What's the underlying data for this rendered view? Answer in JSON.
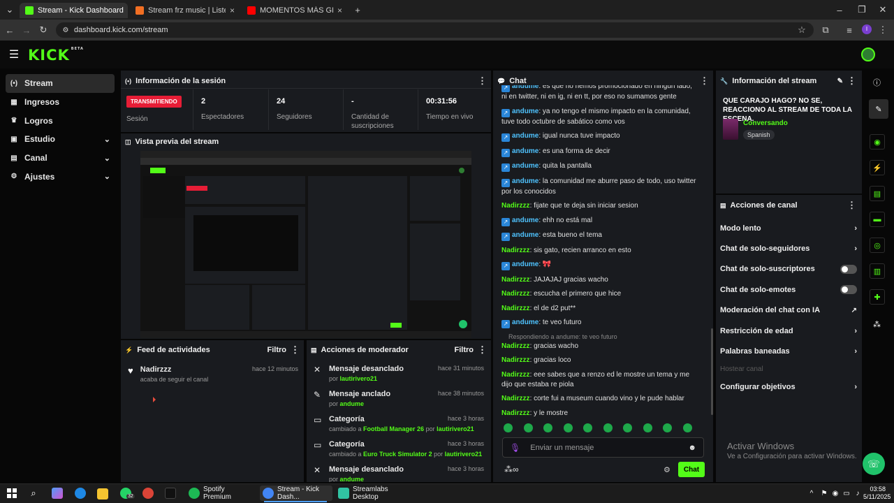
{
  "browser": {
    "tabs": [
      {
        "title": "Stream - Kick Dashboard",
        "color": "#53fc18"
      },
      {
        "title": "Stream frz music | Listen to son",
        "color": "#f26f23"
      },
      {
        "title": "MOMENTOS MÁS GRACIOSOS",
        "color": "#ff0000"
      }
    ],
    "url": "dashboard.kick.com/stream"
  },
  "app": {
    "logo": "KICK",
    "beta": "BETA"
  },
  "nav": [
    {
      "label": "Stream",
      "icon": "broadcast-icon"
    },
    {
      "label": "Ingresos",
      "icon": "money-icon"
    },
    {
      "label": "Logros",
      "icon": "trophy-icon"
    },
    {
      "label": "Estudio",
      "icon": "grid-icon"
    },
    {
      "label": "Canal",
      "icon": "channel-icon"
    },
    {
      "label": "Ajustes",
      "icon": "gear-icon"
    }
  ],
  "session": {
    "title": "Información de la sesión",
    "live_label": "TRANSMITIENDO",
    "session_label": "Sesión",
    "stats": [
      {
        "value": "2",
        "label": "Espectadores"
      },
      {
        "value": "24",
        "label": "Seguidores"
      },
      {
        "value": "-",
        "label": "Cantidad de suscripciones"
      },
      {
        "value": "00:31:56",
        "label": "Tiempo en vivo"
      }
    ]
  },
  "preview": {
    "title": "Vista previa del stream"
  },
  "feed": {
    "title": "Feed de actividades",
    "filter": "Filtro",
    "items": [
      {
        "user": "Nadirzzz",
        "text": "acaba de seguir el canal",
        "time": "hace 12 minutos"
      }
    ]
  },
  "mod": {
    "title": "Acciones de moderador",
    "filter": "Filtro",
    "items": [
      {
        "title": "Mensaje desanclado",
        "pre": "por",
        "a": "lautirivero21",
        "mid": "",
        "b": "",
        "time": "hace 31 minutos"
      },
      {
        "title": "Mensaje anclado",
        "pre": "por",
        "a": "andume",
        "mid": "",
        "b": "",
        "time": "hace 38 minutos"
      },
      {
        "title": "Categoría",
        "pre": "cambiado a",
        "a": "Football Manager 26",
        "mid": "por",
        "b": "lautirivero21",
        "time": "hace 3 horas"
      },
      {
        "title": "Categoría",
        "pre": "cambiado a",
        "a": "Euro Truck Simulator 2",
        "mid": "por",
        "b": "lautirivero21",
        "time": "hace 3 horas"
      },
      {
        "title": "Mensaje desanclado",
        "pre": "por",
        "a": "andume",
        "mid": "",
        "b": "",
        "time": "hace 3 horas"
      }
    ]
  },
  "chat": {
    "title": "Chat",
    "messages": [
      {
        "user": "andume",
        "type": "mod",
        "text": "es que no hemos promocionado en ningun lado, ni en twitter, ni en ig, ni en tt, por eso no sumamos gente"
      },
      {
        "user": "andume",
        "type": "mod",
        "text": "ya no tengo el mismo impacto en la comunidad, tuve todo octubre de sabático como vos"
      },
      {
        "user": "andume",
        "type": "mod",
        "text": "igual nunca tuve impacto"
      },
      {
        "user": "andume",
        "type": "mod",
        "text": "es una forma de decir"
      },
      {
        "user": "andume",
        "type": "mod",
        "text": "quita la pantalla"
      },
      {
        "user": "andume",
        "type": "mod",
        "text": "la comunidad me aburre paso de todo, uso twitter por los conocidos"
      },
      {
        "user": "Nadirzzz",
        "type": "user",
        "text": "fijate que te deja sin iniciar sesion"
      },
      {
        "user": "andume",
        "type": "mod",
        "text": "ehh no está mal"
      },
      {
        "user": "andume",
        "type": "mod",
        "text": "esta bueno el tema"
      },
      {
        "user": "Nadirzzz",
        "type": "user",
        "text": "sis gato, recien arranco en esto"
      },
      {
        "user": "andume",
        "type": "mod",
        "text": "🎀"
      },
      {
        "user": "Nadirzzz",
        "type": "user",
        "text": "JAJAJAJ gracias wacho"
      },
      {
        "user": "Nadirzzz",
        "type": "user",
        "text": "escucha el primero que hice"
      },
      {
        "user": "Nadirzzz",
        "type": "user",
        "text": "el de d2 put**"
      },
      {
        "user": "andume",
        "type": "mod",
        "text": "te veo futuro"
      },
      {
        "user": "Nadirzzz",
        "type": "user",
        "text": "gracias wacho",
        "reply": "Respondiendo a andume: te veo futuro"
      },
      {
        "user": "Nadirzzz",
        "type": "user",
        "text": "gracias loco"
      },
      {
        "user": "Nadirzzz",
        "type": "user",
        "text": "eee sabes que a renzo ed le mostre un tema y me dijo que estaba re piola"
      },
      {
        "user": "Nadirzzz",
        "type": "user",
        "text": "corte fui a museum cuando vino y le pude hablar"
      },
      {
        "user": "Nadirzzz",
        "type": "user",
        "text": "y le mostre"
      }
    ],
    "placeholder": "Enviar un mensaje",
    "send": "Chat"
  },
  "stream_info": {
    "title": "Información del stream",
    "stream_title": "QUE CARAJO HAGO? NO SE, REACCIONO AL STREAM DE TODA LA ESCENA.",
    "category": "Conversando",
    "language": "Spanish"
  },
  "channel_actions": {
    "title": "Acciones de canal",
    "items": [
      {
        "label": "Modo lento",
        "control": "chevron"
      },
      {
        "label": "Chat de solo-seguidores",
        "control": "chevron"
      },
      {
        "label": "Chat de solo-suscriptores",
        "control": "toggle"
      },
      {
        "label": "Chat de solo-emotes",
        "control": "toggle"
      },
      {
        "label": "Moderación del chat con IA",
        "control": "external"
      },
      {
        "label": "Restricción de edad",
        "control": "chevron"
      },
      {
        "label": "Palabras baneadas",
        "control": "chevron"
      },
      {
        "label": "Hostear canal",
        "control": "none",
        "disabled": true
      },
      {
        "label": "Configurar objetivos",
        "control": "chevron"
      }
    ]
  },
  "watermark": {
    "title": "Activar Windows",
    "sub": "Ve a Configuración para activar Windows."
  },
  "taskbar": {
    "apps": [
      {
        "label": "Spotify Premium",
        "color": "#1db954"
      },
      {
        "label": "Stream - Kick Dash...",
        "color": "#4285f4"
      },
      {
        "label": "Streamlabs Desktop",
        "color": "#31c3a2"
      }
    ],
    "whatsapp_badge": "32",
    "time": "03:58",
    "date": "5/11/2025"
  },
  "colors": {
    "accent": "#53fc18",
    "live": "#e71d36",
    "mod_name": "#4fc3ff"
  }
}
